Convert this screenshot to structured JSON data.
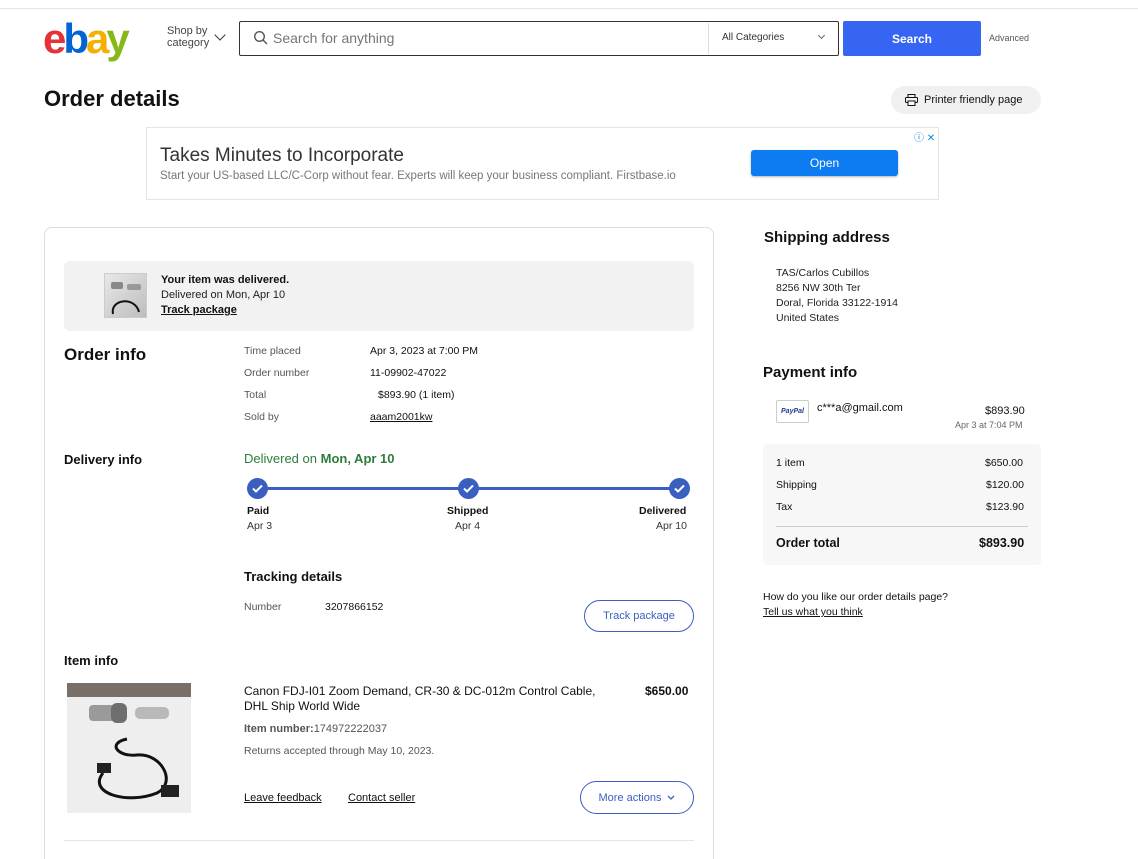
{
  "header": {
    "logo": {
      "e": "e",
      "b": "b",
      "a": "a",
      "y": "y"
    },
    "shop_by_line1": "Shop by",
    "shop_by_line2": "category",
    "search_placeholder": "Search for anything",
    "category_selected": "All Categories",
    "search_button": "Search",
    "advanced_link": "Advanced"
  },
  "page": {
    "title": "Order details",
    "printer_button": "Printer friendly page"
  },
  "ad": {
    "title": "Takes Minutes to Incorporate",
    "subtitle": "Start your US-based LLC/C-Corp without fear. Experts will keep your business compliant. Firstbase.io",
    "button": "Open",
    "icons": "ⓘ ✕"
  },
  "delivery_banner": {
    "title": "Your item was delivered.",
    "subtitle": "Delivered on Mon, Apr 10",
    "link": "Track package"
  },
  "order_info": {
    "heading": "Order info",
    "rows": [
      {
        "label": "Time placed",
        "value": "Apr 3, 2023 at 7:00 PM"
      },
      {
        "label": "Order number",
        "value": "11-09902-47022"
      },
      {
        "label": "Total",
        "value": "$893.90 (1 item)"
      },
      {
        "label": "Sold by",
        "value": "aaam2001kw"
      }
    ]
  },
  "delivery_info": {
    "heading": "Delivery info",
    "status_prefix": "Delivered on ",
    "status_date": "Mon, Apr 10",
    "steps": [
      {
        "label": "Paid",
        "date": "Apr 3"
      },
      {
        "label": "Shipped",
        "date": "Apr 4"
      },
      {
        "label": "Delivered",
        "date": "Apr 10"
      }
    ],
    "progress": 1.0
  },
  "tracking": {
    "heading": "Tracking details",
    "number_label": "Number",
    "number_value": "3207866152",
    "button": "Track package"
  },
  "item_info": {
    "heading": "Item info",
    "title": "Canon FDJ-I01 Zoom Demand, CR-30 & DC-012m Control Cable, DHL Ship World Wide",
    "price": "$650.00",
    "item_number_label": "Item number:",
    "item_number_value": "174972222037",
    "returns": "Returns accepted through May 10, 2023.",
    "leave_feedback": "Leave feedback",
    "contact_seller": "Contact seller",
    "more_actions": "More actions"
  },
  "shipping_address": {
    "heading": "Shipping address",
    "lines": [
      "TAS/Carlos Cubillos",
      "8256 NW 30th Ter",
      "Doral, Florida 33122-1914",
      "United States"
    ]
  },
  "payment_info": {
    "heading": "Payment info",
    "method_logo": "PayPal",
    "email": "c***a@gmail.com",
    "amount": "$893.90",
    "date": "Apr 3 at 7:04 PM",
    "summary": [
      {
        "label": "1 item",
        "value": "$650.00"
      },
      {
        "label": "Shipping",
        "value": "$120.00"
      },
      {
        "label": "Tax",
        "value": "$123.90"
      }
    ],
    "total_label": "Order total",
    "total_value": "$893.90"
  },
  "feedback": {
    "question": "How do you like our order details page?",
    "link": "Tell us what you think"
  },
  "colors": {
    "brand_blue": "#3665f3",
    "progress_blue": "#3b5fc0",
    "delivered_green": "#2d7d3a"
  }
}
